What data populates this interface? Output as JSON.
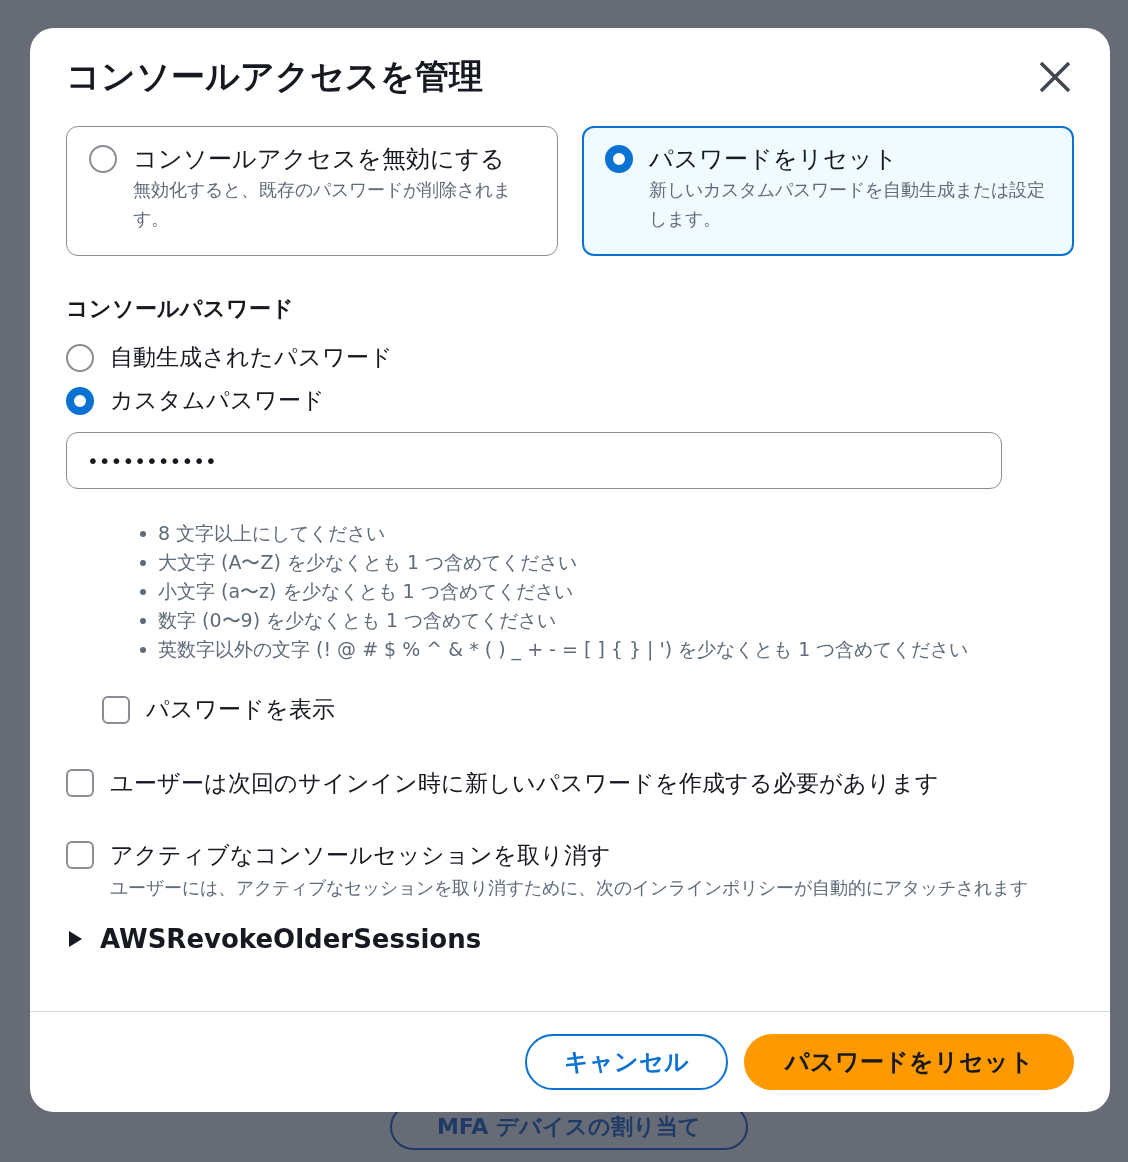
{
  "background": {
    "button": "MFA デバイスの割り当て"
  },
  "dialog": {
    "title": "コンソールアクセスを管理",
    "options": [
      {
        "label": "コンソールアクセスを無効にする",
        "description": "無効化すると、既存のパスワードが削除されます。",
        "selected": false
      },
      {
        "label": "パスワードをリセット",
        "description": "新しいカスタムパスワードを自動生成または設定します。",
        "selected": true
      }
    ],
    "password": {
      "heading": "コンソールパスワード",
      "choices": [
        {
          "label": "自動生成されたパスワード",
          "selected": false
        },
        {
          "label": "カスタムパスワード",
          "selected": true
        }
      ],
      "value": "•••••••••••",
      "requirements": [
        "8 文字以上にしてください",
        "大文字 (A〜Z) を少なくとも 1 つ含めてください",
        "小文字 (a〜z) を少なくとも 1 つ含めてください",
        "数字 (0〜9) を少なくとも 1 つ含めてください",
        "英数字以外の文字 (! @ # $ % ^ & * ( ) _ + - = [ ] { } | ') を少なくとも 1 つ含めてください"
      ],
      "show_password": {
        "label": "パスワードを表示",
        "checked": false
      }
    },
    "checkboxes": [
      {
        "label": "ユーザーは次回のサインイン時に新しいパスワードを作成する必要があります",
        "checked": false
      },
      {
        "label": "アクティブなコンソールセッションを取り消す",
        "checked": false,
        "description": "ユーザーには、アクティブなセッションを取り消すために、次のインラインポリシーが自動的にアタッチされます"
      }
    ],
    "policy": {
      "name": "AWSRevokeOlderSessions",
      "expanded": false
    },
    "buttons": [
      {
        "label": "キャンセル",
        "kind": "secondary"
      },
      {
        "label": "パスワードをリセット",
        "kind": "primary"
      }
    ]
  }
}
